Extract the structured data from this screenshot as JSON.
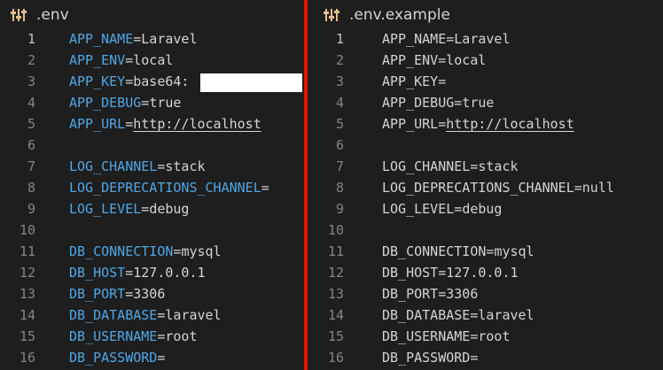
{
  "left": {
    "title": ".env",
    "icon": "settings-sliders-icon",
    "lines": [
      {
        "n": "1",
        "key": "APP_NAME",
        "eq": "=",
        "val": "Laravel"
      },
      {
        "n": "2",
        "key": "APP_ENV",
        "eq": "=",
        "val": "local"
      },
      {
        "n": "3",
        "key": "APP_KEY",
        "eq": "=",
        "val": "base64:"
      },
      {
        "n": "4",
        "key": "APP_DEBUG",
        "eq": "=",
        "val": "true"
      },
      {
        "n": "5",
        "key": "APP_URL",
        "eq": "=",
        "val": "http://localhost"
      },
      {
        "n": "6",
        "key": "",
        "eq": "",
        "val": ""
      },
      {
        "n": "7",
        "key": "LOG_CHANNEL",
        "eq": "=",
        "val": "stack"
      },
      {
        "n": "8",
        "key": "LOG_DEPRECATIONS_CHANNEL",
        "eq": "=",
        "val": ""
      },
      {
        "n": "9",
        "key": "LOG_LEVEL",
        "eq": "=",
        "val": "debug"
      },
      {
        "n": "10",
        "key": "",
        "eq": "",
        "val": ""
      },
      {
        "n": "11",
        "key": "DB_CONNECTION",
        "eq": "=",
        "val": "mysql"
      },
      {
        "n": "12",
        "key": "DB_HOST",
        "eq": "=",
        "val": "127.0.0.1"
      },
      {
        "n": "13",
        "key": "DB_PORT",
        "eq": "=",
        "val": "3306"
      },
      {
        "n": "14",
        "key": "DB_DATABASE",
        "eq": "=",
        "val": "laravel"
      },
      {
        "n": "15",
        "key": "DB_USERNAME",
        "eq": "=",
        "val": "root"
      },
      {
        "n": "16",
        "key": "DB_PASSWORD",
        "eq": "=",
        "val": ""
      }
    ]
  },
  "right": {
    "title": ".env.example",
    "icon": "settings-sliders-icon",
    "lines": [
      {
        "n": "1",
        "key": "APP_NAME",
        "eq": "=",
        "val": "Laravel"
      },
      {
        "n": "2",
        "key": "APP_ENV",
        "eq": "=",
        "val": "local"
      },
      {
        "n": "3",
        "key": "APP_KEY",
        "eq": "=",
        "val": ""
      },
      {
        "n": "4",
        "key": "APP_DEBUG",
        "eq": "=",
        "val": "true"
      },
      {
        "n": "5",
        "key": "APP_URL",
        "eq": "=",
        "val": "http://localhost"
      },
      {
        "n": "6",
        "key": "",
        "eq": "",
        "val": ""
      },
      {
        "n": "7",
        "key": "LOG_CHANNEL",
        "eq": "=",
        "val": "stack"
      },
      {
        "n": "8",
        "key": "LOG_DEPRECATIONS_CHANNEL",
        "eq": "=",
        "val": "null"
      },
      {
        "n": "9",
        "key": "LOG_LEVEL",
        "eq": "=",
        "val": "debug"
      },
      {
        "n": "10",
        "key": "",
        "eq": "",
        "val": ""
      },
      {
        "n": "11",
        "key": "DB_CONNECTION",
        "eq": "=",
        "val": "mysql"
      },
      {
        "n": "12",
        "key": "DB_HOST",
        "eq": "=",
        "val": "127.0.0.1"
      },
      {
        "n": "13",
        "key": "DB_PORT",
        "eq": "=",
        "val": "3306"
      },
      {
        "n": "14",
        "key": "DB_DATABASE",
        "eq": "=",
        "val": "laravel"
      },
      {
        "n": "15",
        "key": "DB_USERNAME",
        "eq": "=",
        "val": "root"
      },
      {
        "n": "16",
        "key": "DB_PASSWORD",
        "eq": "=",
        "val": ""
      }
    ]
  },
  "colors": {
    "background": "#1e1e1e",
    "divider": "#e51400",
    "key_highlight": "#4fa7e6",
    "tab_icon": "#e2c08d"
  }
}
